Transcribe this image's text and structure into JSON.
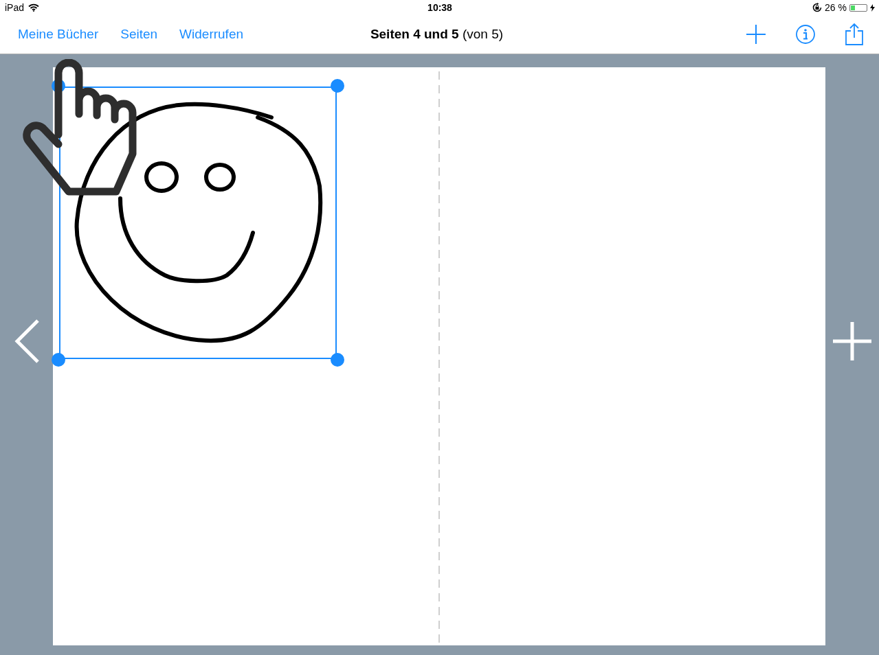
{
  "status_bar": {
    "device": "iPad",
    "time": "10:38",
    "battery_text": "26 %",
    "battery": {
      "level": 0.26,
      "charging": true
    }
  },
  "nav_bar": {
    "left_buttons": [
      "Meine Bücher",
      "Seiten",
      "Widerrufen"
    ],
    "title": "**Seiten 4 und 5** (von 5)"
  },
  "canvas": {
    "selection": {
      "selected": true
    }
  }
}
